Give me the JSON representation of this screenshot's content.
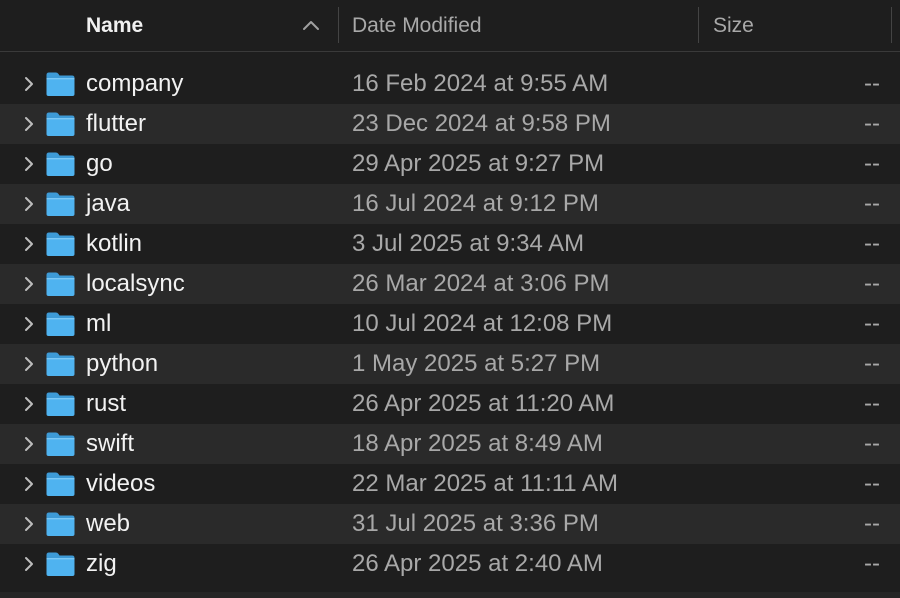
{
  "columns": {
    "name": "Name",
    "date_modified": "Date Modified",
    "size": "Size",
    "sort": "ascending"
  },
  "colors": {
    "background": "#1e1e1e",
    "row_alt": "#2a2a2a",
    "folder_blue": "#4fb3f0",
    "text_primary": "#f2f2f2",
    "text_secondary": "#a8a8a8"
  },
  "items": [
    {
      "name": "company",
      "date": "16 Feb 2024 at 9:55 AM",
      "size": "--",
      "icon": "folder-icon"
    },
    {
      "name": "flutter",
      "date": "23 Dec 2024 at 9:58 PM",
      "size": "--",
      "icon": "folder-icon"
    },
    {
      "name": "go",
      "date": "29 Apr 2025 at 9:27 PM",
      "size": "--",
      "icon": "folder-icon"
    },
    {
      "name": "java",
      "date": "16 Jul 2024 at 9:12 PM",
      "size": "--",
      "icon": "folder-icon"
    },
    {
      "name": "kotlin",
      "date": "3 Jul 2025 at 9:34 AM",
      "size": "--",
      "icon": "folder-icon"
    },
    {
      "name": "localsync",
      "date": "26 Mar 2024 at 3:06 PM",
      "size": "--",
      "icon": "folder-icon"
    },
    {
      "name": "ml",
      "date": "10 Jul 2024 at 12:08 PM",
      "size": "--",
      "icon": "folder-icon"
    },
    {
      "name": "python",
      "date": "1 May 2025 at 5:27 PM",
      "size": "--",
      "icon": "folder-icon"
    },
    {
      "name": "rust",
      "date": "26 Apr 2025 at 11:20 AM",
      "size": "--",
      "icon": "folder-icon"
    },
    {
      "name": "swift",
      "date": "18 Apr 2025 at 8:49 AM",
      "size": "--",
      "icon": "folder-icon"
    },
    {
      "name": "videos",
      "date": "22 Mar 2025 at 11:11 AM",
      "size": "--",
      "icon": "folder-icon"
    },
    {
      "name": "web",
      "date": "31 Jul 2025 at 3:36 PM",
      "size": "--",
      "icon": "folder-icon"
    },
    {
      "name": "zig",
      "date": "26 Apr 2025 at 2:40 AM",
      "size": "--",
      "icon": "folder-icon"
    }
  ]
}
